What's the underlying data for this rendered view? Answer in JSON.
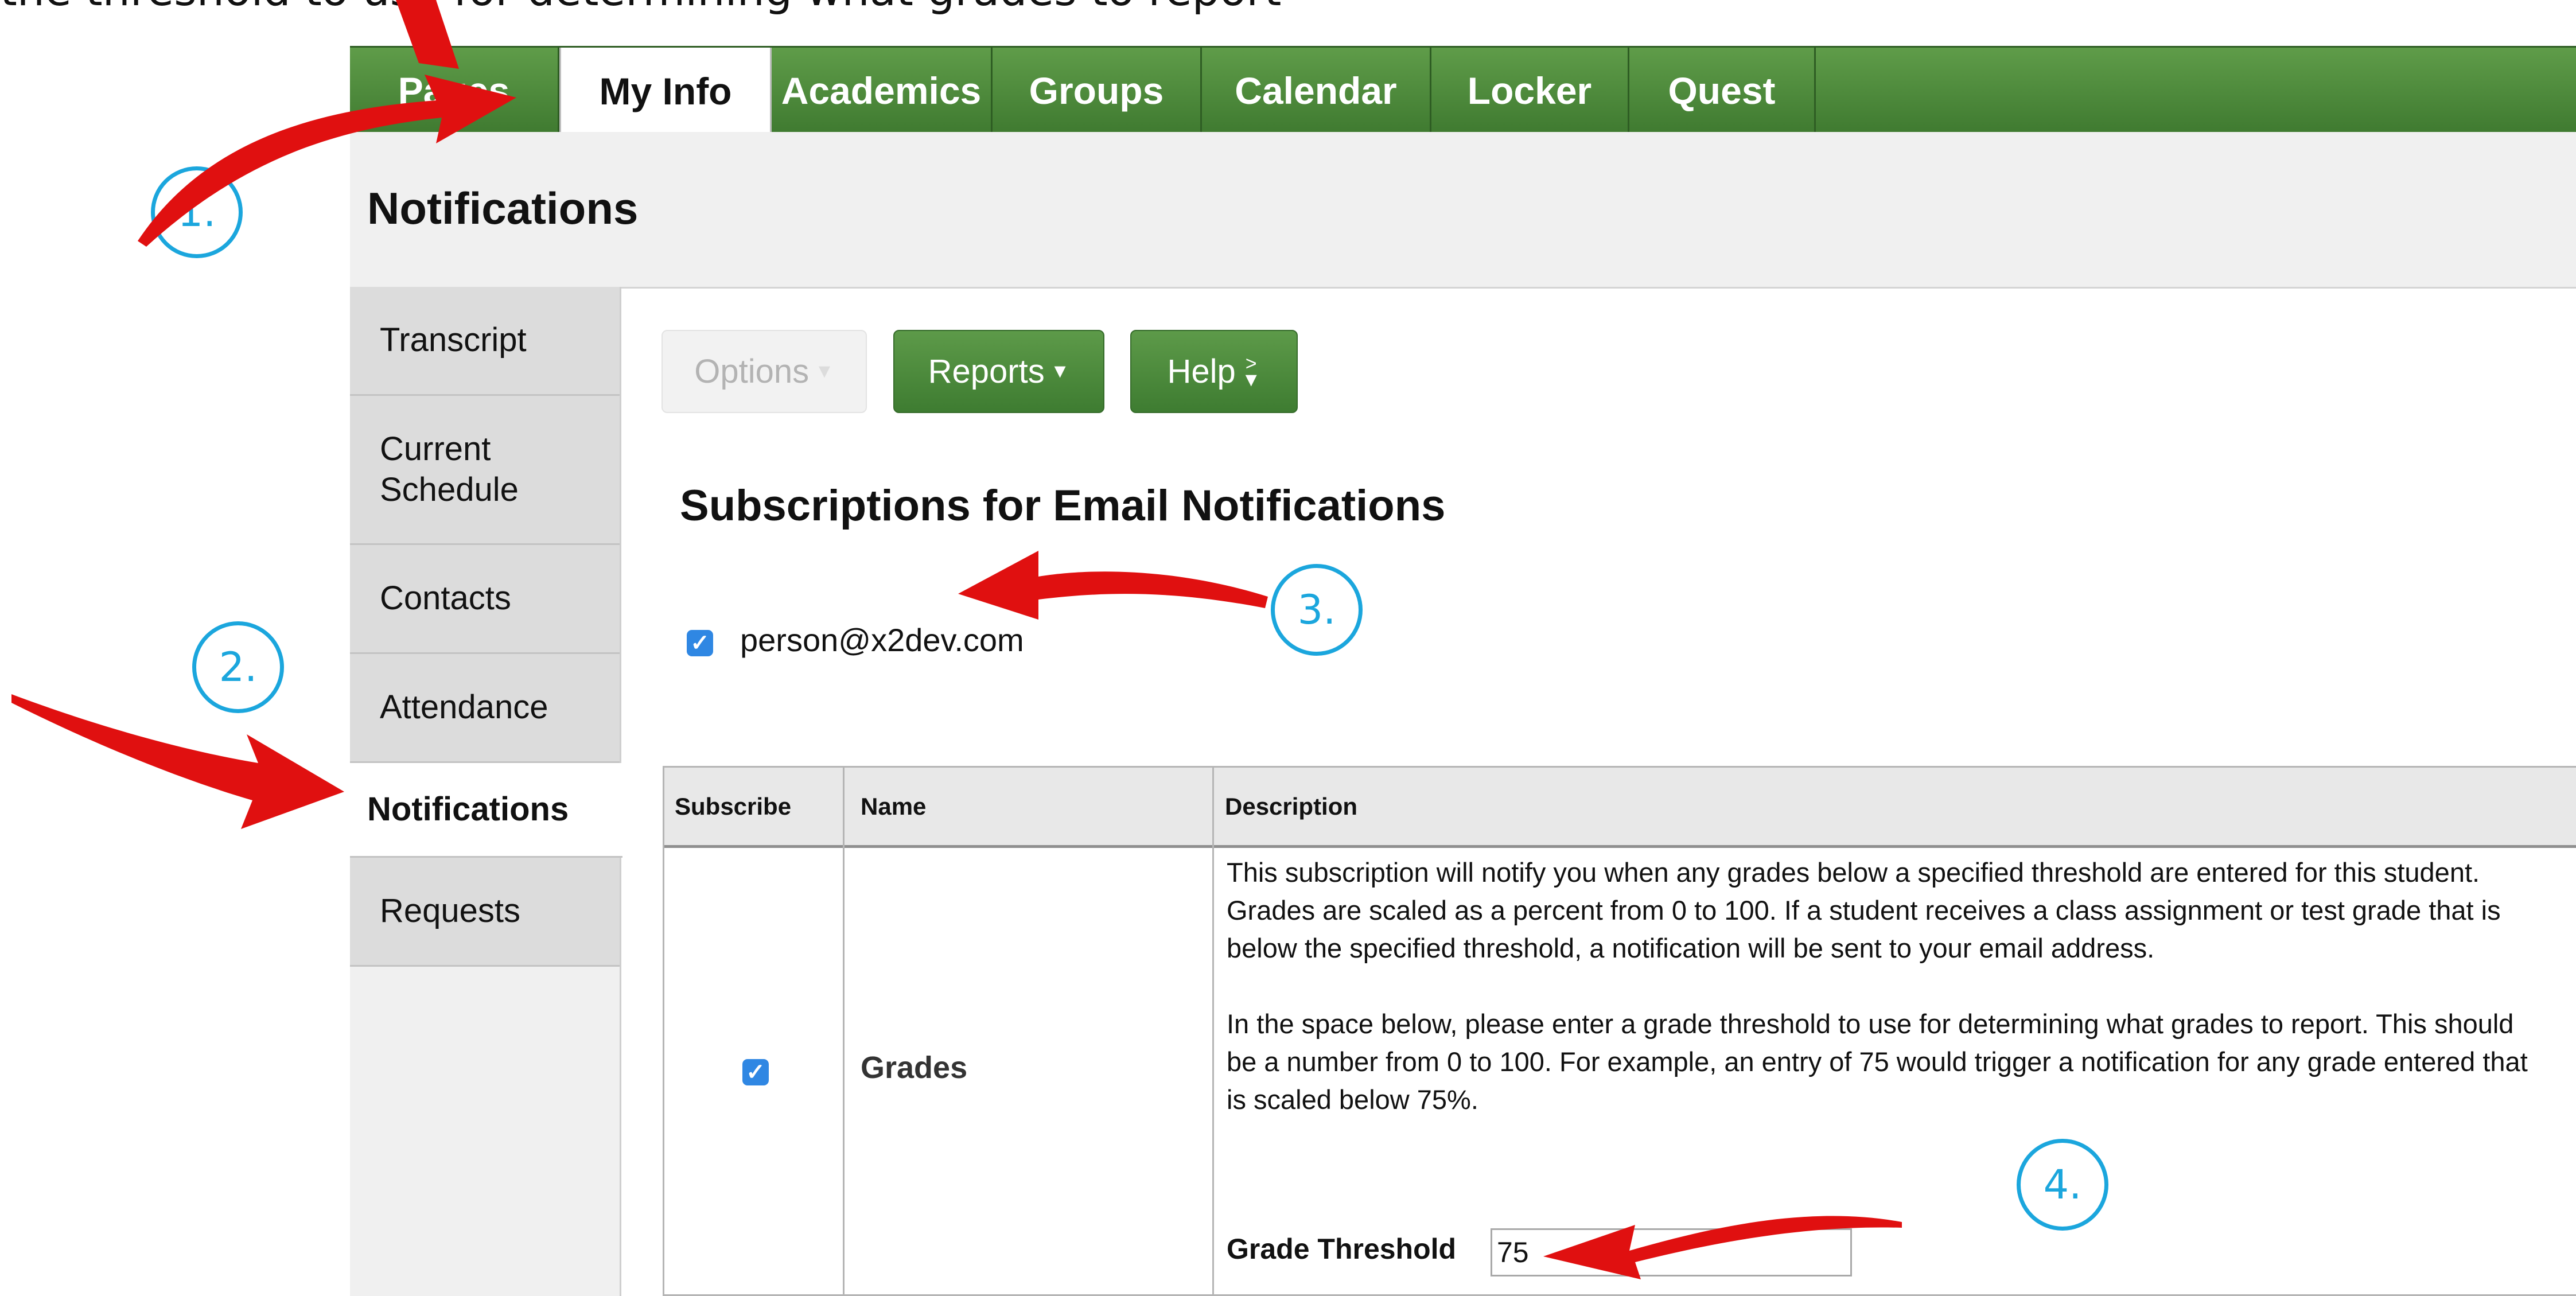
{
  "caption": "the threshold to use for determining what grades to report",
  "nav": {
    "tabs": [
      "Pages",
      "My Info",
      "Academics",
      "Groups",
      "Calendar",
      "Locker",
      "Quest"
    ],
    "active": "My Info"
  },
  "page_title": "Notifications",
  "sidebar": {
    "items": [
      {
        "label": "Transcript"
      },
      {
        "label": "Current Schedule"
      },
      {
        "label": "Contacts"
      },
      {
        "label": "Attendance"
      },
      {
        "label": "Notifications"
      },
      {
        "label": "Requests"
      }
    ],
    "active": "Notifications"
  },
  "toolbar": {
    "options_label": "Options",
    "reports_label": "Reports",
    "help_label": "Help"
  },
  "section_title": "Subscriptions for Email Notifications",
  "email": {
    "address": "person@x2dev.com",
    "checked": true
  },
  "table": {
    "headers": [
      "Subscribe",
      "Name",
      "Description"
    ],
    "row": {
      "subscribed": true,
      "name": "Grades",
      "description_p1": "This subscription will notify you when any grades below a specified threshold are entered for this student. Grades are scaled as a percent from 0 to 100. If a student receives a class assignment or test grade that is below the specified threshold, a notification will be sent to your email address.",
      "description_p2": "In the space below, please enter a grade threshold to use for determining what grades to report. This should be a number from 0 to 100. For example, an entry of 75 would trigger a notification for any grade entered that is scaled below 75%.",
      "threshold_label": "Grade Threshold",
      "threshold_value": "75"
    }
  },
  "annotations": [
    "1.",
    "2.",
    "3.",
    "4."
  ],
  "colors": {
    "nav_green": "#4e8b3d",
    "accent_blue": "#1ba6dd",
    "arrow_red": "#e01010",
    "checkbox_blue": "#2f87e3"
  }
}
